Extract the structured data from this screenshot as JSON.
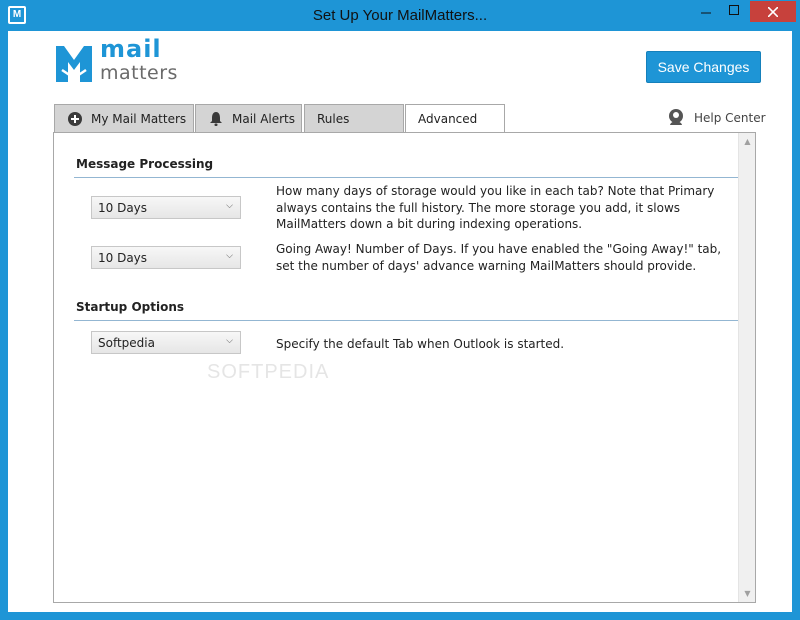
{
  "window": {
    "title": "Set Up Your MailMatters...",
    "min_icon": "minimize-icon",
    "max_icon": "maximize-icon",
    "close_icon": "close-icon"
  },
  "logo": {
    "line1": "mail",
    "line2": "matters"
  },
  "toolbar": {
    "save_label": "Save Changes"
  },
  "tabs": [
    {
      "label": "My Mail Matters",
      "icon": "plus-circle-icon",
      "active": false
    },
    {
      "label": "Mail Alerts",
      "icon": "bell-icon",
      "active": false
    },
    {
      "label": "Rules",
      "active": false
    },
    {
      "label": "Advanced",
      "active": true
    }
  ],
  "help": {
    "label": "Help Center",
    "icon": "help-person-icon"
  },
  "sections": {
    "message_processing": {
      "title": "Message Processing",
      "storage": {
        "value": "10 Days",
        "description": "How many days of storage would you like in each tab? Note that Primary always contains the full history. The more storage you add, it slows MailMatters down a bit during indexing operations."
      },
      "going_away": {
        "value": "10 Days",
        "description": "Going Away! Number of Days. If you have enabled the \"Going Away!\" tab, set the number of days' advance warning MailMatters should provide."
      }
    },
    "startup": {
      "title": "Startup Options",
      "default_tab": {
        "value": "Softpedia",
        "description": "Specify the default Tab when Outlook is started."
      }
    }
  },
  "watermark": "SOFTPEDIA",
  "colors": {
    "accent": "#1e95d6",
    "close": "#c7413c",
    "rule": "#93b6d2"
  }
}
